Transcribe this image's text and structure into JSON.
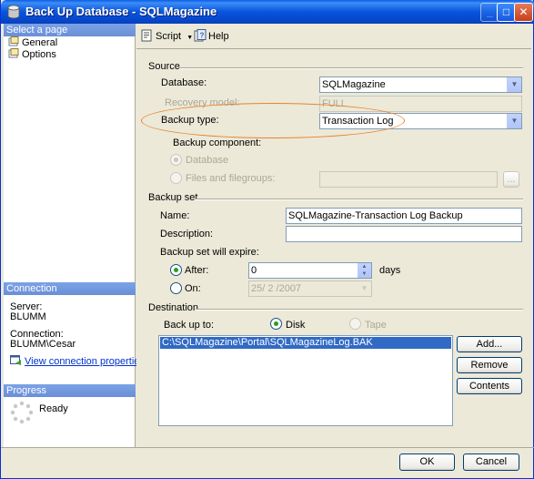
{
  "window": {
    "title": "Back Up Database - SQLMagazine",
    "buttons": {
      "minimize": "_",
      "maximize": "□",
      "close": "✕"
    }
  },
  "left": {
    "select_page_header": "Select a page",
    "pages": [
      {
        "label": "General",
        "icon": "page-icon"
      },
      {
        "label": "Options",
        "icon": "page-icon"
      }
    ],
    "connection_header": "Connection",
    "server_label": "Server:",
    "server_value": "BLUMM",
    "connection_label": "Connection:",
    "connection_value": "BLUMM\\Cesar",
    "view_link": "View connection properties",
    "progress_header": "Progress",
    "progress_status": "Ready"
  },
  "toolbar": {
    "script_label": "Script",
    "help_label": "Help"
  },
  "source": {
    "group_label": "Source",
    "database_label": "Database:",
    "database_value": "SQLMagazine",
    "recovery_label": "Recovery model:",
    "recovery_value": "FULL",
    "backup_type_label": "Backup type:",
    "backup_type_value": "Transaction Log",
    "component_label": "Backup component:",
    "component_database": "Database",
    "component_files": "Files and filegroups:",
    "files_button": "..."
  },
  "backup_set": {
    "group_label": "Backup set",
    "name_label": "Name:",
    "name_value": "SQLMagazine-Transaction Log  Backup",
    "description_label": "Description:",
    "description_value": "",
    "expire_label": "Backup set will expire:",
    "after_label": "After:",
    "after_value": "0",
    "days_label": "days",
    "on_label": "On:",
    "on_value": "25/ 2 /2007"
  },
  "destination": {
    "group_label": "Destination",
    "backup_to_label": "Back up to:",
    "disk_label": "Disk",
    "tape_label": "Tape",
    "paths": [
      "C:\\SQLMagazine\\Portal\\SQLMagazineLog.BAK"
    ],
    "add_button": "Add...",
    "remove_button": "Remove",
    "contents_button": "Contents"
  },
  "footer": {
    "ok_button": "OK",
    "cancel_button": "Cancel"
  },
  "colors": {
    "titlebar": "#0855DD",
    "highlight": "#316AC5",
    "annotation": "#E8832D",
    "dialog_bg": "#ECE9D8"
  }
}
